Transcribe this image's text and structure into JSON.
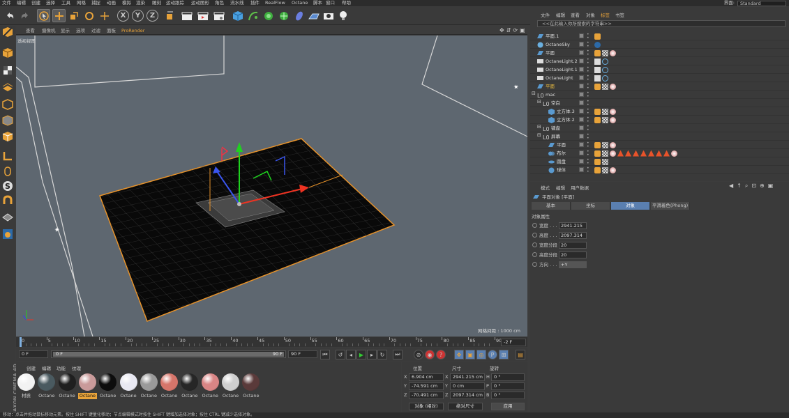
{
  "menu": [
    "文件",
    "编辑",
    "创建",
    "选择",
    "工具",
    "网格",
    "捕捉",
    "动画",
    "模拟",
    "渲染",
    "雕刻",
    "运动跟踪",
    "运动图形",
    "角色",
    "流水线",
    "插件",
    "RealFlow",
    "Octane",
    "脚本",
    "窗口",
    "帮助"
  ],
  "layout": {
    "label": "界面:",
    "value": "Standard"
  },
  "viewport_menu": [
    "查看",
    "摄像机",
    "显示",
    "选项",
    "过滤",
    "面板",
    "ProRender"
  ],
  "viewport_label": "透视视图",
  "grid_label": "网格间距 : 1000 cm",
  "timeline": {
    "ticks": [
      "0",
      "5",
      "10",
      "15",
      "20",
      "25",
      "30",
      "35",
      "40",
      "45",
      "50",
      "55",
      "60",
      "65",
      "70",
      "75",
      "80",
      "85",
      "90"
    ],
    "end_field": "-2 F",
    "start": "0 F",
    "current": "0 F",
    "range_end": "90 F",
    "max": "90 F"
  },
  "material_tabs": [
    "创建",
    "编辑",
    "功能",
    "纹理"
  ],
  "materials": [
    {
      "label": "材质",
      "color": "#f2f2f2",
      "selected": false
    },
    {
      "label": "Octane",
      "color": "#4a5a60",
      "selected": false
    },
    {
      "label": "Octane",
      "color": "#1f1f1f",
      "selected": false
    },
    {
      "label": "Octane",
      "color": "#c99a9a",
      "selected": true
    },
    {
      "label": "Octane",
      "color": "#0d0d0d",
      "selected": false
    },
    {
      "label": "Octane",
      "color": "#e8e8f2",
      "selected": false
    },
    {
      "label": "Octane",
      "color": "#9a9a9a",
      "selected": false
    },
    {
      "label": "Octane",
      "color": "#d6756a",
      "selected": false
    },
    {
      "label": "Octane",
      "color": "#262626",
      "selected": false
    },
    {
      "label": "Octane",
      "color": "#d98585",
      "selected": false
    },
    {
      "label": "Octane",
      "color": "#cfcfcf",
      "selected": false
    },
    {
      "label": "Octane",
      "color": "#5a3a3a",
      "selected": false
    }
  ],
  "coords": {
    "headers": [
      "位置",
      "尺寸",
      "旋转"
    ],
    "rows": [
      {
        "axis": "X",
        "pos": "6.904 cm",
        "size_axis": "X",
        "size": "2941.215 cm",
        "rot_axis": "H",
        "rot": "0 °"
      },
      {
        "axis": "Y",
        "pos": "-74.591 cm",
        "size_axis": "Y",
        "size": "0 cm",
        "rot_axis": "P",
        "rot": "0 °"
      },
      {
        "axis": "Z",
        "pos": "-70.491 cm",
        "size_axis": "Z",
        "size": "2097.314 cm",
        "rot_axis": "B",
        "rot": "0 °"
      }
    ],
    "mode1": "对象 (相对)",
    "mode2": "绝对尺寸",
    "apply": "应用"
  },
  "brand": "MAXON CINEMA 4D",
  "status": "移动：点击并拖动鼠标移动元素。按住 SHIFT 键量化移动；节点编辑模式时按住 SHIFT 键增加选择对象；按住 CTRL 键减少选择对象。",
  "object_manager": {
    "menu": [
      "文件",
      "编辑",
      "查看",
      "对象",
      "标签",
      "书签"
    ],
    "search_placeholder": "<<在此输入你所搜索的字符串>>",
    "rows": [
      {
        "name": "平面.1",
        "indent": 0,
        "icon": "plane"
      },
      {
        "name": "OctaneSky",
        "indent": 0,
        "icon": "sky"
      },
      {
        "name": "平面",
        "indent": 0,
        "icon": "plane"
      },
      {
        "name": "OctaneLight.2",
        "indent": 0,
        "icon": "light"
      },
      {
        "name": "OctaneLight.1",
        "indent": 0,
        "icon": "light"
      },
      {
        "name": "OctaneLight",
        "indent": 0,
        "icon": "light"
      },
      {
        "name": "平面",
        "indent": 0,
        "icon": "plane",
        "highlight": true
      },
      {
        "name": "mac",
        "indent": 0,
        "icon": "null"
      },
      {
        "name": "空白",
        "indent": 1,
        "icon": "null"
      },
      {
        "name": "立方体.3",
        "indent": 2,
        "icon": "cube"
      },
      {
        "name": "立方体.2",
        "indent": 2,
        "icon": "cube"
      },
      {
        "name": "键盘",
        "indent": 1,
        "icon": "null"
      },
      {
        "name": "屏幕",
        "indent": 1,
        "icon": "null"
      },
      {
        "name": "平面",
        "indent": 2,
        "icon": "plane"
      },
      {
        "name": "布尔",
        "indent": 2,
        "icon": "bool"
      },
      {
        "name": "圆盘",
        "indent": 2,
        "icon": "disc"
      },
      {
        "name": "球体",
        "indent": 2,
        "icon": "sphere"
      }
    ]
  },
  "attributes": {
    "menu": [
      "模式",
      "编辑",
      "用户数据"
    ],
    "object_title": "平面对象 [平面]",
    "tabs": [
      "基本",
      "坐标",
      "对象",
      "平滑着色(Phong)"
    ],
    "section": "对象属性",
    "props": [
      {
        "label": "宽度 . . . .",
        "value": "2941.215"
      },
      {
        "label": "高度 . . . .",
        "value": "2097.314"
      },
      {
        "label": "宽度分段",
        "value": "20"
      },
      {
        "label": "高度分段",
        "value": "20"
      },
      {
        "label": "方向 . . . .",
        "value": "+Y"
      }
    ]
  }
}
